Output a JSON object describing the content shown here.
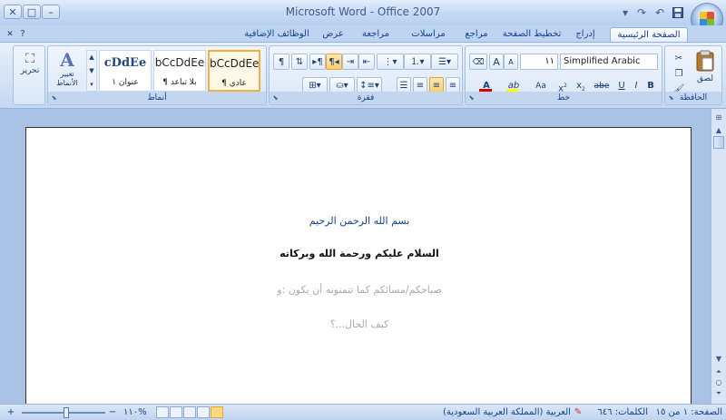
{
  "window": {
    "title": "Microsoft Word - Office 2007",
    "controls": {
      "minimize": "–",
      "maximize": "□",
      "close": "✕"
    }
  },
  "quick_access": {
    "save_icon": "save-icon",
    "undo_icon": "undo-icon",
    "redo_icon": "redo-icon",
    "customize_icon": "chevron-down-icon"
  },
  "tabs": [
    {
      "label": "الصفحة الرئيسية",
      "active": true
    },
    {
      "label": "إدراج"
    },
    {
      "label": "تخطيط الصفحة"
    },
    {
      "label": "مراجع"
    },
    {
      "label": "مراسلات"
    },
    {
      "label": "مراجعة"
    },
    {
      "label": "عرض"
    },
    {
      "label": "الوظائف الإضافية"
    }
  ],
  "ribbon": {
    "help_icon": "?",
    "minimize_ribbon": "✕",
    "clipboard": {
      "label": "الحافظة",
      "paste": "لصق",
      "cut_icon": "scissors-icon",
      "copy_icon": "copy-icon",
      "format_painter_icon": "brush-icon"
    },
    "font": {
      "label": "خط",
      "font_name": "Simplified Arabic",
      "font_size": "١١",
      "grow": "A",
      "shrink": "A",
      "clear": "Aa",
      "bold": "B",
      "italic": "I",
      "underline": "U",
      "strike": "abe",
      "subscript": "x",
      "superscript": "x",
      "change_case": "Aa",
      "highlight": "ab",
      "font_color": "A"
    },
    "paragraph": {
      "label": "فقرة"
    },
    "styles": {
      "label": "أنماط",
      "tiles": [
        {
          "sample": "bCcDdEe",
          "name": "¶ عادي",
          "selected": true
        },
        {
          "sample": "bCcDdEe",
          "name": "¶ بلا تباعد"
        },
        {
          "sample": "cDdEe",
          "name": "عنوان ١"
        }
      ],
      "change_styles": "تغيير الأنماط"
    },
    "editing": {
      "label": "تحرير"
    }
  },
  "document": {
    "lines": [
      {
        "text": "بسم الله الرحمن الرحيم",
        "color": "#333333",
        "bold": false
      },
      {
        "text": "السلام عليكم ورحمة الله وبركاته",
        "color": "#111111",
        "bold": true
      },
      {
        "text": "صباحكم/مسائكم كما تتمنونه أن يكون :و",
        "color": "#a9a9a9",
        "bold": false
      },
      {
        "text": "كيف الحال...؟",
        "color": "#a9a9a9",
        "bold": false
      }
    ]
  },
  "status_bar": {
    "page": "الصفحة: ١ من ١٥",
    "words": "الكلمات: ٦٤٦",
    "language": "العربية (المملكة العربية السعودية)",
    "zoom": "١١٠%",
    "zoom_minus": "−",
    "zoom_plus": "+"
  },
  "colors": {
    "accent": "#15428b",
    "font_color_bar": "#d40000",
    "highlight_bar": "#ffff00"
  }
}
